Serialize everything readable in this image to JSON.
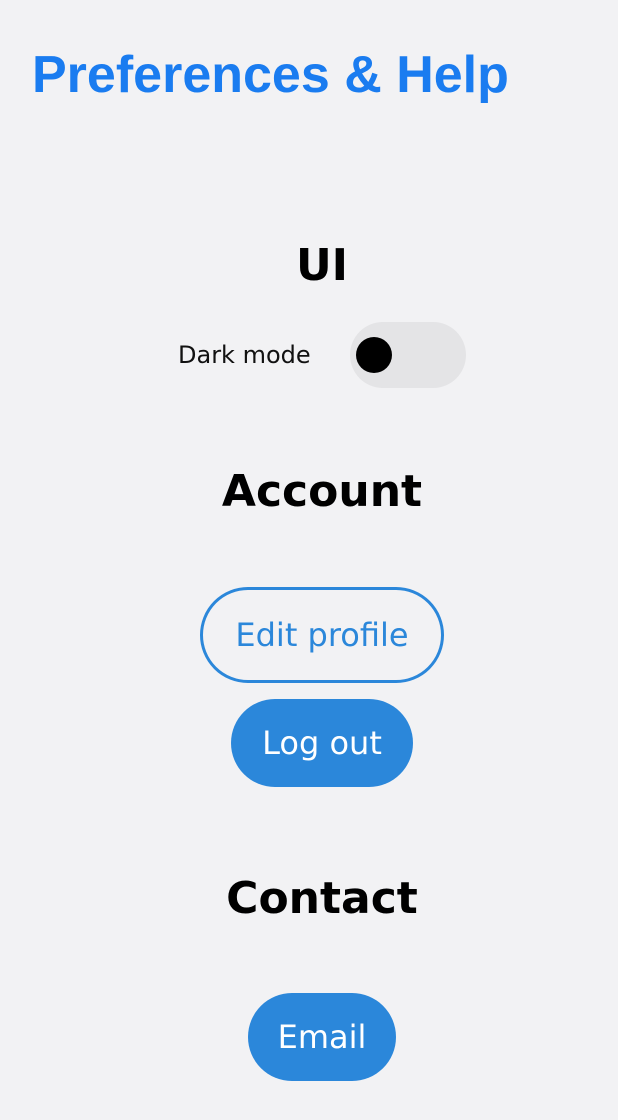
{
  "header": {
    "title": "Preferences & Help"
  },
  "sections": {
    "ui": {
      "heading": "UI",
      "dark_mode": {
        "label": "Dark mode",
        "enabled": false
      }
    },
    "account": {
      "heading": "Account",
      "edit_profile_label": "Edit profile",
      "log_out_label": "Log out"
    },
    "contact": {
      "heading": "Contact",
      "email_label": "Email"
    }
  },
  "colors": {
    "accent": "#1a7cf0",
    "button": "#2b87da",
    "background": "#f2f2f4",
    "toggle_track": "#e4e4e6",
    "toggle_knob": "#000000"
  }
}
